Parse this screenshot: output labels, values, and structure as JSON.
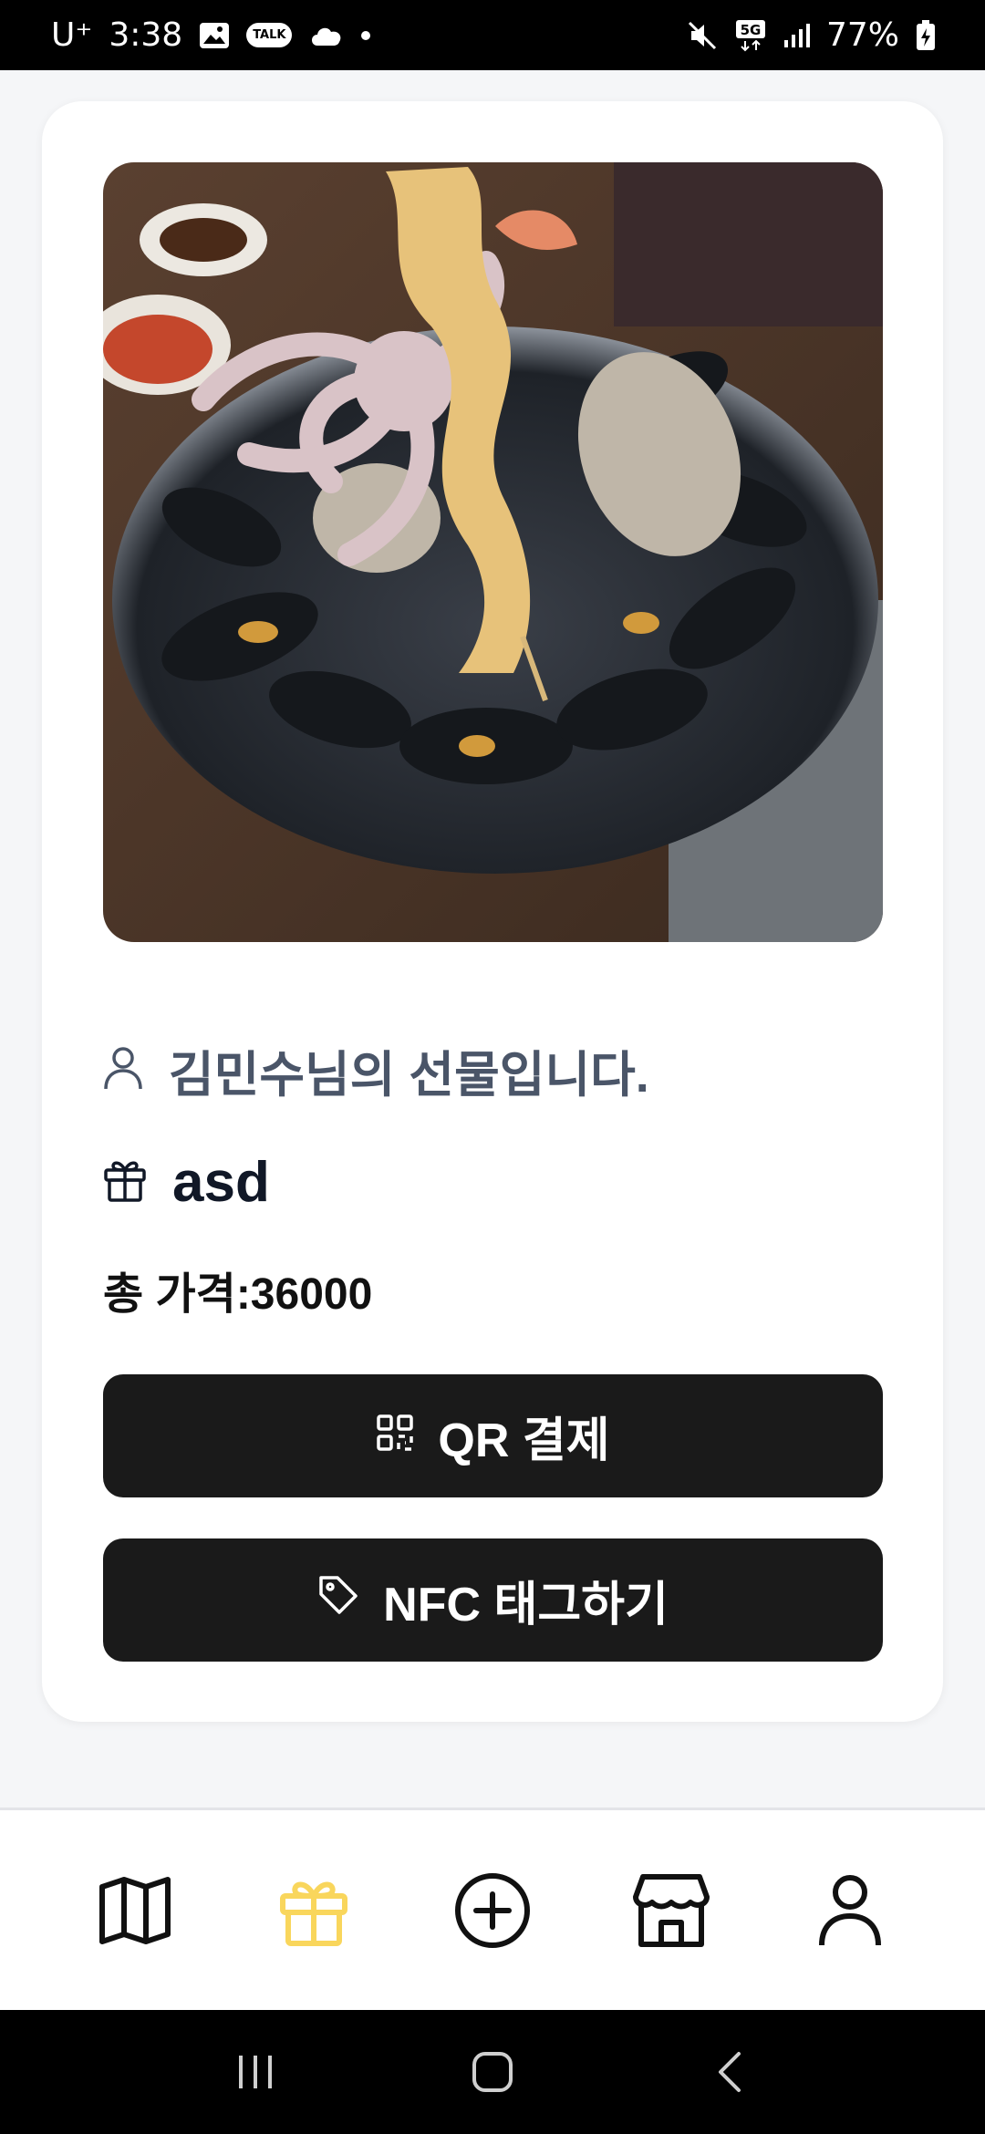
{
  "status_bar": {
    "carrier": "U⁺",
    "time": "3:38",
    "kakao_badge": "TALK",
    "network": "5G",
    "battery": "77%"
  },
  "gift": {
    "sender_message": "김민수님의 선물입니다.",
    "name": "asd",
    "price_text": "총 가격:36000"
  },
  "actions": {
    "qr_label": "QR 결제",
    "nfc_label": "NFC 태그하기"
  },
  "bottom_nav": {
    "items": [
      "map",
      "gift",
      "add",
      "store",
      "profile"
    ],
    "active": "gift",
    "active_color": "#f9d65c",
    "inactive_color": "#111111"
  }
}
